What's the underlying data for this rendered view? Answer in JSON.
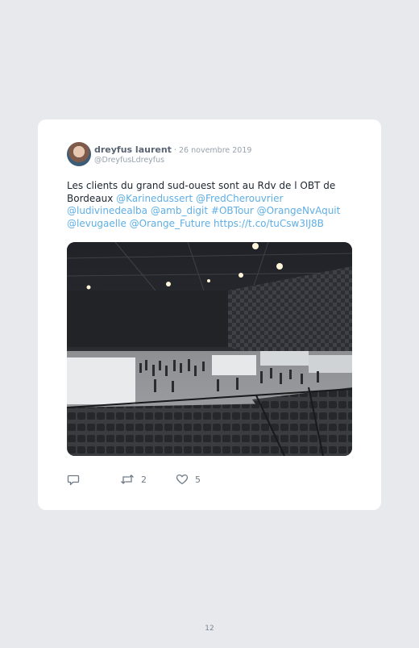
{
  "tweet": {
    "author_name": "dreyfus laurent",
    "separator": " · ",
    "date": "26 novembre 2019",
    "handle": "@DreyfusLdreyfus",
    "text_plain": "Les clients du grand sud-ouest sont au Rdv de l OBT de Bordeaux ",
    "links": [
      "@Karinedussert",
      "@FredCherouvrier",
      "@ludivinedealba",
      "@amb_digit",
      "#OBTour",
      "@OrangeNvAquit",
      "@levugaelle",
      "@Orange_Future",
      "https://t.co/tuCsw3IJ8B"
    ],
    "retweet_count": "2",
    "like_count": "5"
  },
  "icons": {
    "reply": "reply-icon",
    "retweet": "retweet-icon",
    "like": "heart-icon"
  },
  "colors": {
    "link": "#5faee4",
    "background": "#e7e9ec",
    "card": "#ffffff"
  },
  "page": {
    "number": "12"
  }
}
